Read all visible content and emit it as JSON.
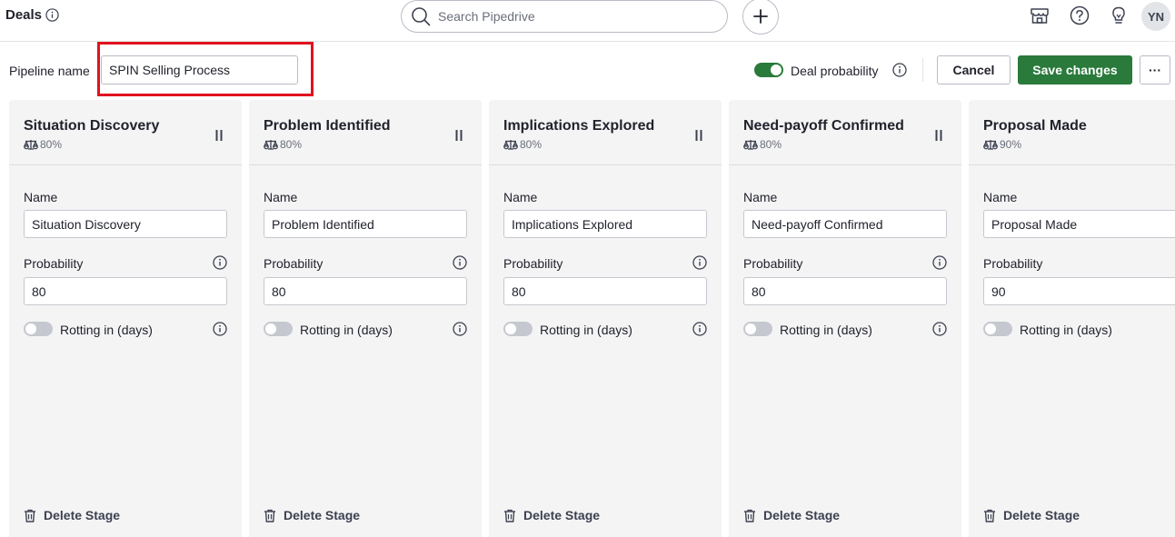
{
  "header": {
    "title": "Deals",
    "search_placeholder": "Search Pipedrive",
    "avatar_initials": "YN"
  },
  "pipeline": {
    "label": "Pipeline name",
    "value": "SPIN Selling Process",
    "deal_probability_label": "Deal probability",
    "deal_probability_enabled": true,
    "cancel_label": "Cancel",
    "save_label": "Save changes",
    "more_label": "···"
  },
  "stage_labels": {
    "name": "Name",
    "probability": "Probability",
    "rotting": "Rotting in (days)",
    "delete": "Delete Stage"
  },
  "stages": [
    {
      "title": "Situation Discovery",
      "percent": "80%",
      "name": "Situation Discovery",
      "probability": "80"
    },
    {
      "title": "Problem Identified",
      "percent": "80%",
      "name": "Problem Identified",
      "probability": "80"
    },
    {
      "title": "Implications Explored",
      "percent": "80%",
      "name": "Implications Explored",
      "probability": "80"
    },
    {
      "title": "Need-payoff Confirmed",
      "percent": "80%",
      "name": "Need-payoff Confirmed",
      "probability": "80"
    },
    {
      "title": "Proposal Made",
      "percent": "90%",
      "name": "Proposal Made",
      "probability": "90"
    }
  ],
  "colors": {
    "accent": "#2a7a3b",
    "highlight": "#e0121f"
  }
}
